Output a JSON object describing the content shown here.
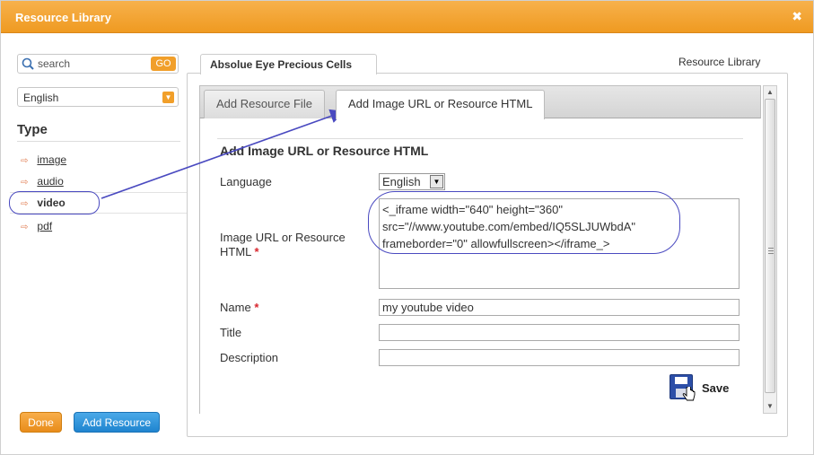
{
  "window": {
    "title": "Resource Library",
    "close_glyph": "✖"
  },
  "left": {
    "search": {
      "value": "search",
      "go_label": "GO"
    },
    "language": {
      "selected": "English"
    },
    "type_heading": "Type",
    "types": [
      {
        "label": "image",
        "active": false
      },
      {
        "label": "audio",
        "active": false
      },
      {
        "label": "video",
        "active": true
      },
      {
        "label": "pdf",
        "active": false
      }
    ],
    "done_label": "Done",
    "add_resource_label": "Add Resource"
  },
  "right": {
    "outer_tab": "Absolue Eye Precious Cells",
    "outer_link": "Resource Library",
    "tabs": [
      {
        "label": "Add Resource File",
        "active": false
      },
      {
        "label": "Add Image URL or Resource HTML",
        "active": true
      }
    ],
    "section_title": "Add Image URL or Resource HTML",
    "form": {
      "language_label": "Language",
      "language_value": "English",
      "url_label": "Image URL or Resource HTML",
      "url_value": "<_iframe width=\"640\" height=\"360\"\nsrc=\"//www.youtube.com/embed/IQ5SLJUWbdA\"\nframeborder=\"0\" allowfullscreen></iframe_>",
      "name_label": "Name",
      "name_value": "my youtube video",
      "title_label": "Title",
      "title_value": "",
      "description_label": "Description",
      "description_value": "",
      "required_mark": "*",
      "save_label": "Save"
    }
  },
  "colors": {
    "titlebar": "#ef9a21",
    "go_button": "#f19f2a",
    "done_button": "#e88c1a",
    "add_button": "#1f84cf",
    "annotation": "#4a4ac0",
    "required": "#d8262e"
  },
  "icons": [
    "search-icon",
    "chevron-down-icon",
    "arrow-bullet-icon",
    "save-disk-icon",
    "hand-cursor-icon",
    "close-icon"
  ]
}
